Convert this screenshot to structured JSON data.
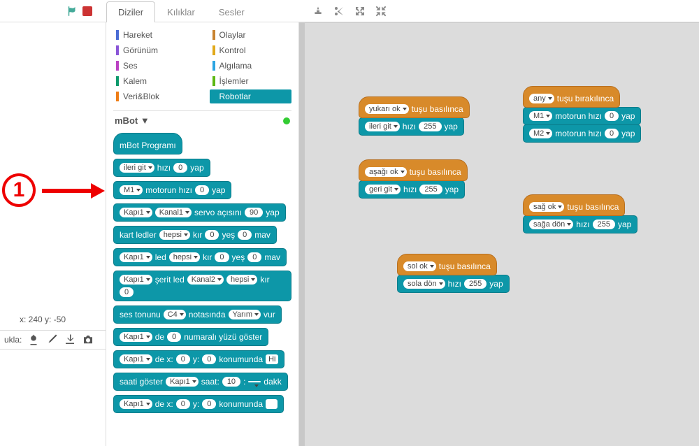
{
  "tabs": {
    "scripts": "Diziler",
    "costumes": "Kılıklar",
    "sounds": "Sesler"
  },
  "categories": {
    "motion": "Hareket",
    "looks": "Görünüm",
    "sound": "Ses",
    "pen": "Kalem",
    "data": "Veri&Blok",
    "events": "Olaylar",
    "control": "Kontrol",
    "sensing": "Algılama",
    "operators": "İşlemler",
    "robots": "Robotlar"
  },
  "cat_colors": {
    "motion": "#4a6cd4",
    "looks": "#8a55d7",
    "sound": "#bb42c3",
    "pen": "#0e9a6c",
    "data": "#ee7d16",
    "events": "#c88330",
    "control": "#e1a91a",
    "sensing": "#2ca5e2",
    "operators": "#5cb712",
    "robots": "#0d97a8"
  },
  "mbot": "mBot",
  "coords": "x: 240 y: -50",
  "ukla": "ukla:",
  "palette": {
    "b0": "mBot Programı",
    "b1": {
      "d1": "ileri git",
      "t1": "hızı",
      "n1": "0",
      "t2": "yap"
    },
    "b2": {
      "d1": "M1",
      "t1": "motorun hızı",
      "n1": "0",
      "t2": "yap"
    },
    "b3": {
      "d1": "Kapı1",
      "d2": "Kanal1",
      "t1": "servo açısını",
      "n1": "90",
      "t2": "yap"
    },
    "b4": {
      "t1": "kart ledler",
      "d1": "hepsi",
      "t2": "kır",
      "n1": "0",
      "t3": "yeş",
      "n2": "0",
      "t4": "mav"
    },
    "b5": {
      "d1": "Kapı1",
      "t1": "led",
      "d2": "hepsi",
      "t2": "kır",
      "n1": "0",
      "t3": "yeş",
      "n2": "0",
      "t4": "mav"
    },
    "b6": {
      "d1": "Kapı1",
      "t1": "şerit led",
      "d2": "Kanal2",
      "d3": "hepsi",
      "t2": "kır",
      "n1": "0"
    },
    "b7": {
      "t1": "ses tonunu",
      "d1": "C4",
      "t2": "notasında",
      "d2": "Yarım",
      "t3": "vur"
    },
    "b8": {
      "d1": "Kapı1",
      "t1": "de",
      "n1": "0",
      "t2": "numaralı yüzü göster"
    },
    "b9": {
      "d1": "Kapı1",
      "t1": "de x:",
      "n1": "0",
      "t2": "y:",
      "n2": "0",
      "t3": "konumunda",
      "tx": "Hi"
    },
    "b10": {
      "t1": "saati göster",
      "d1": "Kapı1",
      "t2": "saat:",
      "n1": "10",
      "t3": ":",
      "d2": "",
      "t4": "dakk"
    },
    "b11": {
      "d1": "Kapı1",
      "t1": "de x:",
      "n1": "0",
      "t2": "y:",
      "n2": "0",
      "t3": "konumunda"
    }
  },
  "canvas": {
    "up": {
      "key": "yukarı ok",
      "label": "tuşu basılınca",
      "cmd": "ileri git",
      "spd": "hızı",
      "val": "255",
      "suf": "yap"
    },
    "down": {
      "key": "aşağı ok",
      "label": "tuşu basılınca",
      "cmd": "geri git",
      "spd": "hızı",
      "val": "255",
      "suf": "yap"
    },
    "right": {
      "key": "sağ ok",
      "label": "tuşu basılınca",
      "cmd": "sağa dön",
      "spd": "hızı",
      "val": "255",
      "suf": "yap"
    },
    "left": {
      "key": "sol ok",
      "label": "tuşu basılınca",
      "cmd": "sola dön",
      "spd": "hızı",
      "val": "255",
      "suf": "yap"
    },
    "release": {
      "key": "any",
      "label": "tuşu bırakılınca",
      "m1": "M1",
      "m2": "M2",
      "t": "motorun hızı",
      "val": "0",
      "suf": "yap"
    }
  },
  "annotation": "1"
}
